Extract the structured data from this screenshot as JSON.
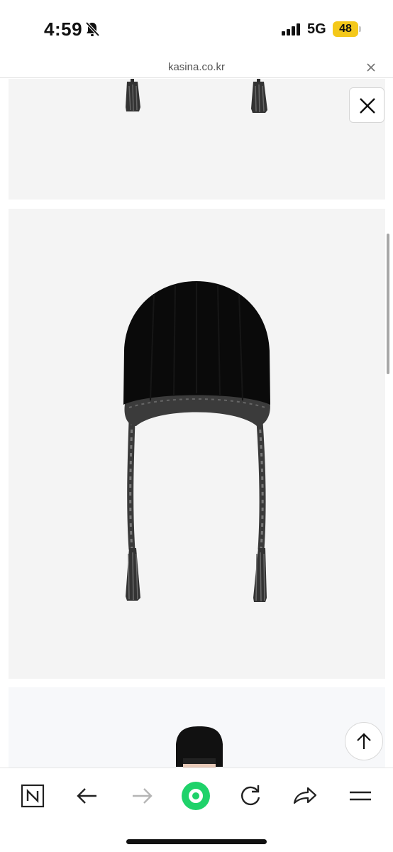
{
  "status_bar": {
    "time": "4:59",
    "network": "5G",
    "battery": "48",
    "icons": [
      "bell-muted-icon",
      "signal-icon",
      "battery-icon"
    ]
  },
  "browser": {
    "url": "kasina.co.kr",
    "close_icon": "close-icon"
  },
  "viewer": {
    "close_icon": "close-icon",
    "scroll_top_icon": "arrow-up-icon"
  },
  "toolbar": {
    "items": [
      "naver-home-icon",
      "back-arrow-icon",
      "forward-arrow-icon",
      "green-dot-icon",
      "reload-icon",
      "share-icon",
      "menu-icon"
    ]
  },
  "colors": {
    "accent_green": "#1fd26a",
    "battery_yellow": "#f4c81a",
    "panel_gray": "#f4f4f4"
  }
}
